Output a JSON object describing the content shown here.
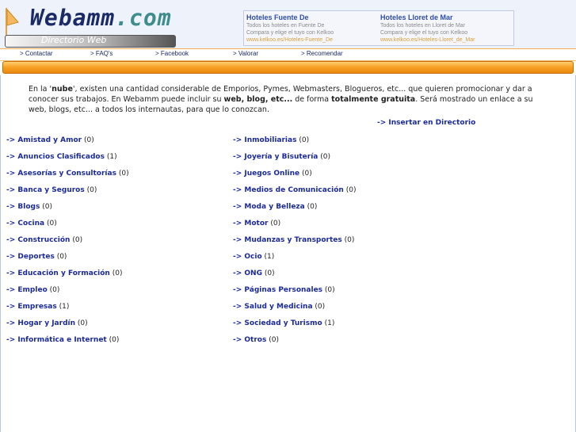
{
  "header": {
    "logo": {
      "main": "Webamm",
      "suffix": ".com"
    },
    "directory_label": "Directorio Web",
    "ads": [
      {
        "title": "Hoteles Fuente De",
        "desc1": "Todos los hoteles en Fuente De",
        "desc2": "Compara y elige el tuyo con Kelkoo",
        "url": "www.kelkoo.es/Hoteles-Fuente_De"
      },
      {
        "title": "Hoteles Lloret de Mar",
        "desc1": "Todos los hoteles en Lloret de Mar",
        "desc2": "Compara y elige el tuyo con Kelkoo",
        "url": "www.kelkoo.es/Hoteles-Lloret_de_Mar"
      }
    ]
  },
  "nav": [
    {
      "label": "> Contactar"
    },
    {
      "label": "> FAQ's"
    },
    {
      "label": "> Facebook"
    },
    {
      "label": "> Valorar"
    },
    {
      "label": "> Recomendar"
    }
  ],
  "intro": {
    "p1": "En la '",
    "b1": "nube",
    "p2": "', existen una cantidad considerable de Emporios, Pymes, Webmasters, Blogueros, etc... que quieren promocionar y dar a conocer sus trabajos. En Webamm puede incluir su ",
    "b2": "web, blog, etc...",
    "p3": " de forma ",
    "b3": "totalmente gratuita",
    "p4": ". Será mostrado un enlace a su web, blogs, etc... a todos los internautas, para que lo conozcan."
  },
  "insert_link": "-> Insertar en Directorio",
  "categories": {
    "left": [
      {
        "label": "-> Amistad y Amor",
        "count": "(0)"
      },
      {
        "label": "-> Anuncios Clasificados",
        "count": "(1)"
      },
      {
        "label": "-> Asesorías y Consultorías",
        "count": "(0)"
      },
      {
        "label": "-> Banca y Seguros",
        "count": "(0)"
      },
      {
        "label": "-> Blogs",
        "count": "(0)"
      },
      {
        "label": "-> Cocina",
        "count": "(0)"
      },
      {
        "label": "-> Construcción",
        "count": "(0)"
      },
      {
        "label": "-> Deportes",
        "count": "(0)"
      },
      {
        "label": "-> Educación y Formación",
        "count": "(0)"
      },
      {
        "label": "-> Empleo",
        "count": "(0)"
      },
      {
        "label": "-> Empresas",
        "count": "(1)"
      },
      {
        "label": "-> Hogar y Jardín",
        "count": "(0)"
      },
      {
        "label": "-> Informática e Internet",
        "count": "(0)"
      }
    ],
    "right": [
      {
        "label": "-> Inmobiliarias",
        "count": "(0)"
      },
      {
        "label": "-> Joyería y Bisutería",
        "count": "(0)"
      },
      {
        "label": "-> Juegos Online",
        "count": "(0)"
      },
      {
        "label": "-> Medios de Comunicación",
        "count": "(0)"
      },
      {
        "label": "-> Moda y Belleza",
        "count": "(0)"
      },
      {
        "label": "-> Motor",
        "count": "(0)"
      },
      {
        "label": "-> Mudanzas y Transportes",
        "count": "(0)"
      },
      {
        "label": "-> Ocio",
        "count": "(1)"
      },
      {
        "label": "-> ONG",
        "count": "(0)"
      },
      {
        "label": "-> Páginas Personales",
        "count": "(0)"
      },
      {
        "label": "-> Salud y Medicina",
        "count": "(0)"
      },
      {
        "label": "-> Sociedad y Turismo",
        "count": "(1)"
      },
      {
        "label": "-> Otros",
        "count": "(0)"
      }
    ]
  },
  "colors": {
    "link": "#1a2a99",
    "accent": "#f7a021",
    "header_bg": "#eef3fb"
  }
}
